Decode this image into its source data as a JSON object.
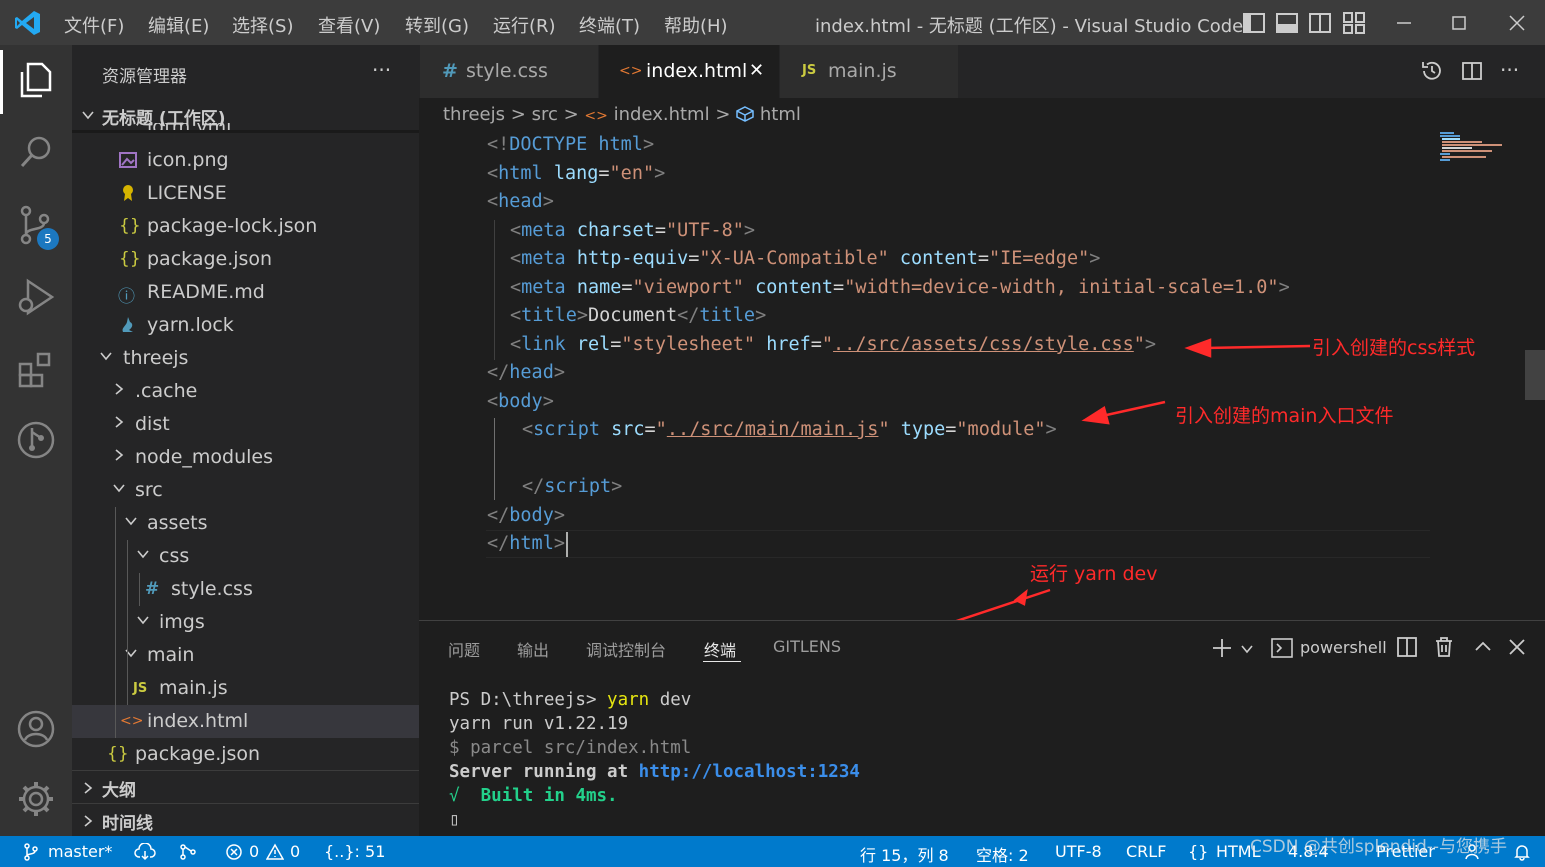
{
  "titlebar": {
    "menus": [
      "文件(F)",
      "编辑(E)",
      "选择(S)",
      "查看(V)",
      "转到(G)",
      "运行(R)",
      "终端(T)",
      "帮助(H)"
    ],
    "title": "index.html - 无标题 (工作区) - Visual Studio Code"
  },
  "activity": {
    "scm_badge": "5"
  },
  "sidebar": {
    "title": "资源管理器",
    "more": "···",
    "workspace": "无标题 (工作区)",
    "partial_item": "lgtm.yml",
    "items": [
      {
        "label": "icon.png",
        "icon": "image-icon"
      },
      {
        "label": "LICENSE",
        "icon": "license-icon"
      },
      {
        "label": "package-lock.json",
        "icon": "json-icon"
      },
      {
        "label": "package.json",
        "icon": "json-icon"
      },
      {
        "label": "README.md",
        "icon": "info-icon"
      },
      {
        "label": "yarn.lock",
        "icon": "yarn-icon"
      },
      {
        "label": "threejs",
        "icon": "folder-open"
      },
      {
        "label": ".cache",
        "icon": "folder-closed"
      },
      {
        "label": "dist",
        "icon": "folder-closed"
      },
      {
        "label": "node_modules",
        "icon": "folder-closed"
      },
      {
        "label": "src",
        "icon": "folder-open"
      },
      {
        "label": "assets",
        "icon": "folder-open"
      },
      {
        "label": "css",
        "icon": "folder-open"
      },
      {
        "label": "style.css",
        "icon": "css-icon"
      },
      {
        "label": "imgs",
        "icon": "folder-open"
      },
      {
        "label": "main",
        "icon": "folder-open"
      },
      {
        "label": "main.js",
        "icon": "js-icon"
      },
      {
        "label": "index.html",
        "icon": "html-icon"
      },
      {
        "label": "package.json",
        "icon": "json-icon"
      }
    ],
    "outline": "大纲",
    "timeline": "时间线"
  },
  "glyphs": {
    "json": "{}",
    "css": "#",
    "js": "JS",
    "html": "<>",
    "info": "ⓘ",
    "close": "✕",
    "term_cursor": "▯",
    "check": "√"
  },
  "tabs": [
    {
      "label": "style.css"
    },
    {
      "label": "index.html"
    },
    {
      "label": "main.js"
    }
  ],
  "breadcrumb": {
    "p1": "threejs",
    "p2": "src",
    "p3": "index.html",
    "p4": "html",
    "sep": ">"
  },
  "code": {
    "l1_a": "<!",
    "l1_b": "DOCTYPE",
    "l1_c": " html",
    "l1_d": ">",
    "l2_a": "<",
    "l2_b": "html",
    "l2_c": " lang",
    "l2_d": "=",
    "l2_e": "\"en\"",
    "l2_f": ">",
    "l3_a": "<",
    "l3_b": "head",
    "l3_c": ">",
    "l4_b": "meta",
    "l4_c": " charset",
    "l4_e": "\"UTF-8\"",
    "l5_b": "meta",
    "l5_c": " http-equiv",
    "l5_e": "\"X-UA-Compatible\"",
    "l5_f": " content",
    "l5_g": "\"IE=edge\"",
    "l6_b": "meta",
    "l6_c": " name",
    "l6_e": "\"viewport\"",
    "l6_f": " content",
    "l6_g": "\"width=device-width, initial-scale=1.0\"",
    "l7_b": "title",
    "l7_c": "Document",
    "l7_d": "</",
    "l7_e": "title",
    "l8_b": "link",
    "l8_c": " rel",
    "l8_e": "\"stylesheet\"",
    "l8_f": " href",
    "l8_q": "\"",
    "l8_g": "../src/assets/css/style.css",
    "l9_a": "</",
    "l9_b": "head",
    "l10_b": "body",
    "l11_b": "script",
    "l11_c": " src",
    "l11_g": "../src/main/main.js",
    "l11_f": " type",
    "l11_h": "\"module\"",
    "l12_a": "</",
    "l12_b": "script",
    "l13_b": "body",
    "l14_b": "html"
  },
  "annotations": {
    "css": "引入创建的css样式",
    "main": "引入创建的main入口文件",
    "yarn": "运行 yarn dev"
  },
  "panel": {
    "tabs": [
      "问题",
      "输出",
      "调试控制台",
      "终端",
      "GITLENS"
    ],
    "shell": "powershell"
  },
  "terminal": {
    "prompt": "PS D:\\threejs> ",
    "cmd1": "yarn",
    "cmd2": " dev",
    "l2": "yarn run v1.22.19",
    "l3": "$ parcel src/index.html",
    "l4a": "Server running at ",
    "l4b": "http://localhost:1234",
    "l5b": "Built in 4ms."
  },
  "status": {
    "branch": "master*",
    "errors": "0",
    "warnings": "0",
    "braces": "{..}: 51",
    "position": "行 15，列 8",
    "spaces": "空格: 2",
    "encoding": "UTF-8",
    "eol": "CRLF",
    "lang": "HTML",
    "version": "4.8.4",
    "prettier": "Prettier"
  },
  "watermark": "CSDN @共创splendid--与您携手",
  "colors": {
    "accent": "#007acc",
    "annotation": "#ff2a2a",
    "tag": "#569cd6",
    "attr": "#9cdcfe",
    "string": "#ce9178"
  }
}
